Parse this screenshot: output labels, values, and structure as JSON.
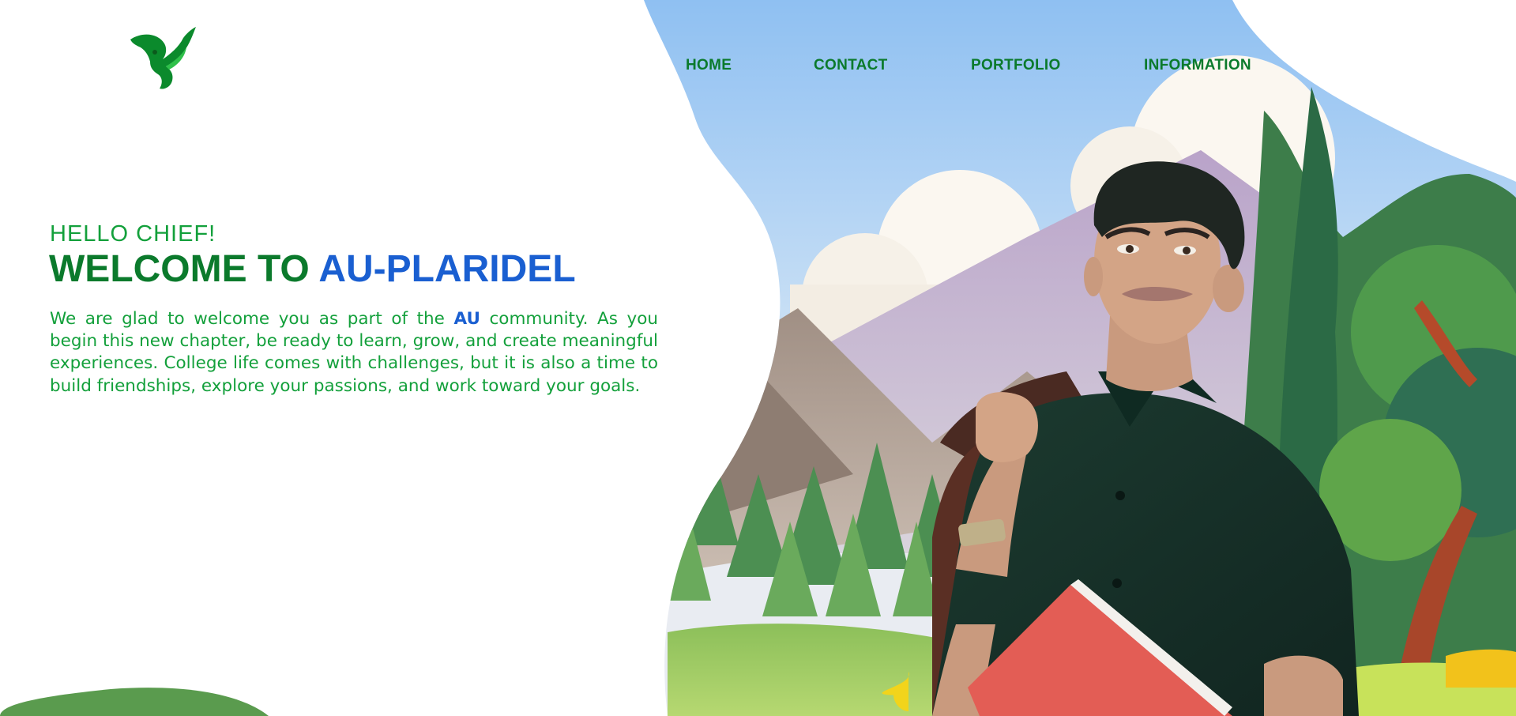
{
  "nav": {
    "items": [
      {
        "label": "HOME"
      },
      {
        "label": "CONTACT"
      },
      {
        "label": "PORTFOLIO"
      },
      {
        "label": "INFORMATION"
      }
    ]
  },
  "logo": {
    "icon": "eagle-logo-icon"
  },
  "hero": {
    "greeting": "HELLO CHIEF!",
    "headline_part1": "WELCOME TO",
    "headline_part2": "AU-PLARIDEL",
    "intro_before": "We are glad to welcome you as part of the",
    "intro_highlight": "AU",
    "intro_after": "community. As you begin this new chapter, be ready to learn, grow, and create meaningful experiences. College life comes with challenges, but it is also a time to build friendships, explore your passions, and work toward your goals."
  },
  "colors": {
    "brand_green": "#0b7a2c",
    "text_green": "#13a03b",
    "accent_blue": "#1a5fd1",
    "background": "#ffffff"
  }
}
